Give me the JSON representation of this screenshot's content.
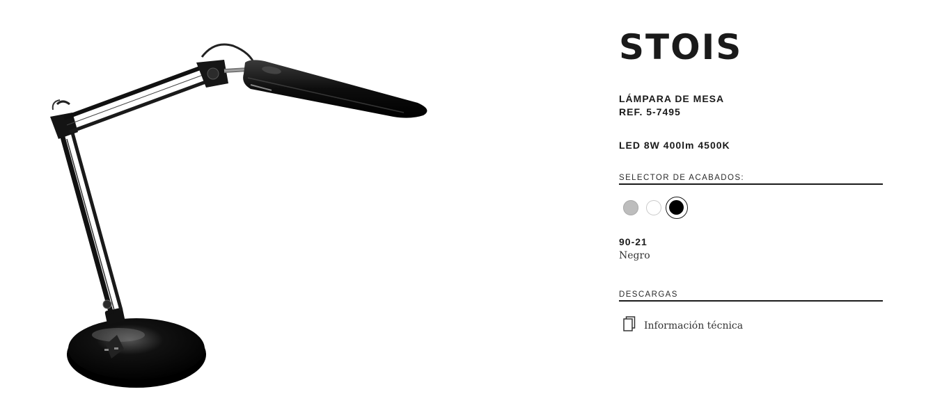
{
  "product": {
    "name": "STOIS",
    "type": "LÁMPARA DE MESA",
    "reference": "REF. 5-7495",
    "spec": "LED 8W 400lm 4500K",
    "image_icon": "desk-lamp"
  },
  "finish_selector": {
    "label": "SELECTOR DE ACABADOS:",
    "swatches": [
      {
        "name": "grey",
        "color": "#bdbdbd",
        "selected": false
      },
      {
        "name": "white",
        "color": "#ffffff",
        "selected": false
      },
      {
        "name": "black",
        "color": "#000000",
        "selected": true
      }
    ],
    "selected_code": "90-21",
    "selected_name": "Negro"
  },
  "downloads": {
    "label": "DESCARGAS",
    "items": [
      {
        "label": "Información técnica",
        "icon": "document-icon"
      }
    ]
  }
}
